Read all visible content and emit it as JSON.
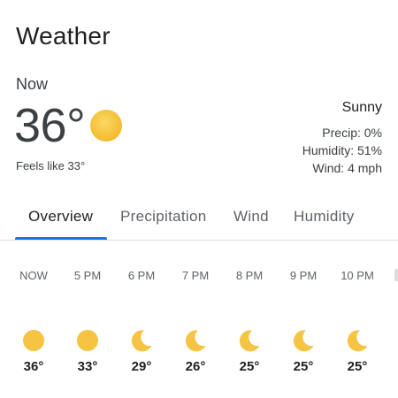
{
  "app": {
    "title": "Weather"
  },
  "current": {
    "label": "Now",
    "temperature": "36°",
    "icon": "sun-icon",
    "feels_like": "Feels like 33°",
    "condition": "Sunny",
    "precip": "Precip: 0%",
    "humidity": "Humidity: 51%",
    "wind": "Wind: 4 mph"
  },
  "tabs": [
    {
      "label": "Overview",
      "active": true
    },
    {
      "label": "Precipitation",
      "active": false
    },
    {
      "label": "Wind",
      "active": false
    },
    {
      "label": "Humidity",
      "active": false
    }
  ],
  "hourly": [
    {
      "time": "NOW",
      "temp": "36°",
      "icon": "sun-icon"
    },
    {
      "time": "5 PM",
      "temp": "33°",
      "icon": "sun-icon"
    },
    {
      "time": "6 PM",
      "temp": "29°",
      "icon": "moon-icon"
    },
    {
      "time": "7 PM",
      "temp": "26°",
      "icon": "moon-icon"
    },
    {
      "time": "8 PM",
      "temp": "25°",
      "icon": "moon-icon"
    },
    {
      "time": "9 PM",
      "temp": "25°",
      "icon": "moon-icon"
    },
    {
      "time": "10 PM",
      "temp": "25°",
      "icon": "moon-icon"
    }
  ],
  "colors": {
    "sun": "#f6c343",
    "moon": "#f6c343",
    "accent": "#1a73e8",
    "divider": "#dadce0"
  }
}
